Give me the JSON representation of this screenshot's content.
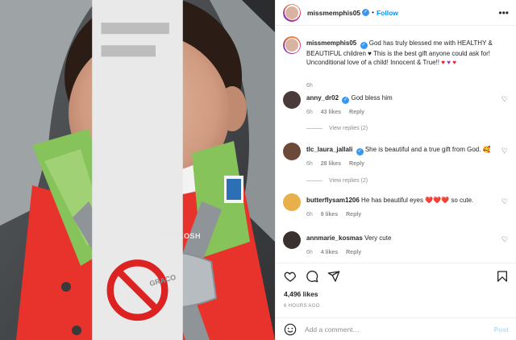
{
  "post": {
    "author": "missmemphis05",
    "follow_label": "Follow",
    "more_icon": "more-options-icon",
    "caption": "God has truly blessed me with HEALTHY & BEAUTIFUL children ♥ This is the best gift anyone could ask for! Unconditional love of a child! Innocent & True!!",
    "caption_time": "6h",
    "photo": {
      "brand_tag": "OSHKOSH",
      "buckle_text": "GRACO"
    }
  },
  "comments": [
    {
      "user": "anny_dr02",
      "verified": true,
      "text": "God bless him",
      "time": "6h",
      "likes": "43 likes",
      "reply_label": "Reply",
      "view_replies": "View replies (2)"
    },
    {
      "user": "tlc_laura_jallali",
      "verified": true,
      "text": "She is beautiful and a true gift from God. 🥰",
      "time": "6h",
      "likes": "28 likes",
      "reply_label": "Reply",
      "view_replies": "View replies (2)"
    },
    {
      "user": "butterflysam1206",
      "verified": false,
      "text": "He has beautiful eyes ❤️❤️❤️ so cute.",
      "time": "6h",
      "likes": "9 likes",
      "reply_label": "Reply"
    },
    {
      "user": "annmarie_kosmas",
      "verified": false,
      "text": "Very cute",
      "time": "6h",
      "likes": "4 likes",
      "reply_label": "Reply"
    }
  ],
  "actions": {
    "like_icon": "heart-icon",
    "comment_icon": "comment-icon",
    "share_icon": "share-icon",
    "save_icon": "bookmark-icon",
    "likes": "4,496 likes",
    "timestamp": "6 HOURS AGO"
  },
  "add_comment": {
    "placeholder": "Add a comment…",
    "post_label": "Post"
  },
  "colors": {
    "accent": "#0095f6",
    "post_disabled": "#b2dffc",
    "verified": "#3897f0",
    "muted": "#8e8e8e"
  }
}
